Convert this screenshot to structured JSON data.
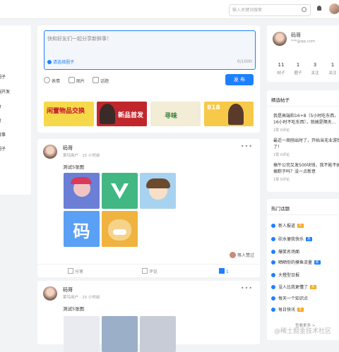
{
  "header": {
    "search_placeholder": "输入关键词搜索"
  },
  "left_nav": {
    "items": [
      "圈子",
      "端开发",
      "",
      "食",
      "",
      "发",
      "",
      "解事",
      "圈子"
    ]
  },
  "composer": {
    "placeholder": "快和好友们一起分享新鲜事！",
    "circle_select": "请选择圈子",
    "counter": "0/1000",
    "tools": [
      "表情",
      "图片",
      "话题"
    ],
    "publish_label": "发 布"
  },
  "banners": [
    {
      "text": "闲置物品交换",
      "color": "#c8102e",
      "bg": "#f5d94a"
    },
    {
      "text": "新品首发",
      "color": "#ffffff",
      "bg": "#c1262c"
    },
    {
      "text": "寻味",
      "color": "#2e7d32",
      "bg": "#f3ecd6"
    },
    {
      "text": "818",
      "color": "#ffffff",
      "bg": "#f7c948"
    }
  ],
  "posts": [
    {
      "author": "码哥",
      "meta": "莱坞用户 · 15 小时前",
      "text": "测试5张图",
      "likes_text": "等人赞过",
      "actions": [
        "分享",
        "评论",
        "1"
      ]
    },
    {
      "author": "码哥",
      "meta": "莱坞用户 · 15 小时前",
      "text": "测试5张图"
    }
  ],
  "profile": {
    "name": "码哥",
    "email": "***@qq.com",
    "stats": [
      {
        "n": "11",
        "l": "帖子"
      },
      {
        "n": "1",
        "l": "圈子"
      },
      {
        "n": "3",
        "l": "关注"
      },
      {
        "n": "1",
        "l": "关注"
      }
    ]
  },
  "featured": {
    "title": "精选帖子",
    "items": [
      {
        "text": "我是高端和16+8（5小时吃东西，16小时不吃东西），就搞是隔天...",
        "count": "1赞 0评论"
      },
      {
        "text": "最近一周刚出时了，开始当无业游民了！",
        "count": "1赞 0评论"
      },
      {
        "text": "搞午公司又发500块钱，我不能不搞搞粽子吗？没一点新意",
        "count": "1赞 0评论"
      }
    ]
  },
  "topics": {
    "title": "热门话题",
    "items": [
      {
        "label": "新人报道",
        "badge": "热",
        "badge_color": "#f5a623"
      },
      {
        "label": "砍水便我快乐",
        "badge": "热",
        "badge_color": "#1e80ff"
      },
      {
        "label": "爆笑名场面",
        "badge": "",
        "badge_color": ""
      },
      {
        "label": "晒晒你的摸鱼流量",
        "badge": "新",
        "badge_color": "#1e80ff"
      },
      {
        "label": "大橙型日报",
        "badge": "",
        "badge_color": ""
      },
      {
        "label": "没人比我更懂了",
        "badge": "热",
        "badge_color": "#f5a623"
      },
      {
        "label": "每天一个知识点",
        "badge": "",
        "badge_color": ""
      },
      {
        "label": "每日快讯",
        "badge": "热",
        "badge_color": "#f5a623"
      }
    ],
    "more": "查看更多 >"
  },
  "watermark": "@稀土掘金技术社区"
}
